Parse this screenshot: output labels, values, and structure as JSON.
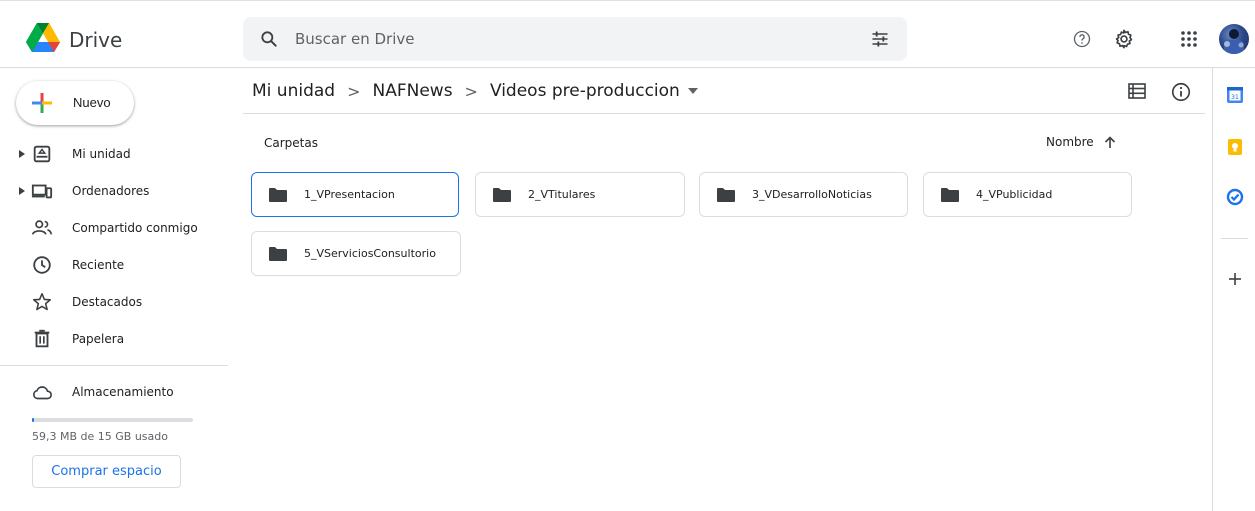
{
  "app": {
    "name": "Drive"
  },
  "search": {
    "placeholder": "Buscar en Drive"
  },
  "sidebar": {
    "new_label": "Nuevo",
    "items": [
      {
        "label": "Mi unidad",
        "icon": "my-drive-icon",
        "expandable": true
      },
      {
        "label": "Ordenadores",
        "icon": "computers-icon",
        "expandable": true
      },
      {
        "label": "Compartido conmigo",
        "icon": "shared-icon",
        "expandable": false
      },
      {
        "label": "Reciente",
        "icon": "clock-icon",
        "expandable": false
      },
      {
        "label": "Destacados",
        "icon": "star-icon",
        "expandable": false
      },
      {
        "label": "Papelera",
        "icon": "trash-icon",
        "expandable": false
      }
    ],
    "storage": {
      "label": "Almacenamiento",
      "usage_text": "59,3 MB de 15 GB usado",
      "used_fraction": 0.004,
      "buy_label": "Comprar espacio"
    }
  },
  "breadcrumb": {
    "items": [
      "Mi unidad",
      "NAFNews",
      "Videos pre-produccion"
    ],
    "separator": ">"
  },
  "main": {
    "section_title": "Carpetas",
    "sort_label": "Nombre",
    "folders": [
      {
        "name": "1_VPresentacion",
        "selected": true
      },
      {
        "name": "2_VTitulares",
        "selected": false
      },
      {
        "name": "3_VDesarrolloNoticias",
        "selected": false
      },
      {
        "name": "4_VPublicidad",
        "selected": false
      },
      {
        "name": "5_VServiciosConsultorio",
        "selected": false
      }
    ]
  },
  "colors": {
    "accent": "#1a73e8",
    "text": "#202124",
    "muted": "#5f6368",
    "border": "#dadce0",
    "search_bg": "#f1f3f4"
  }
}
